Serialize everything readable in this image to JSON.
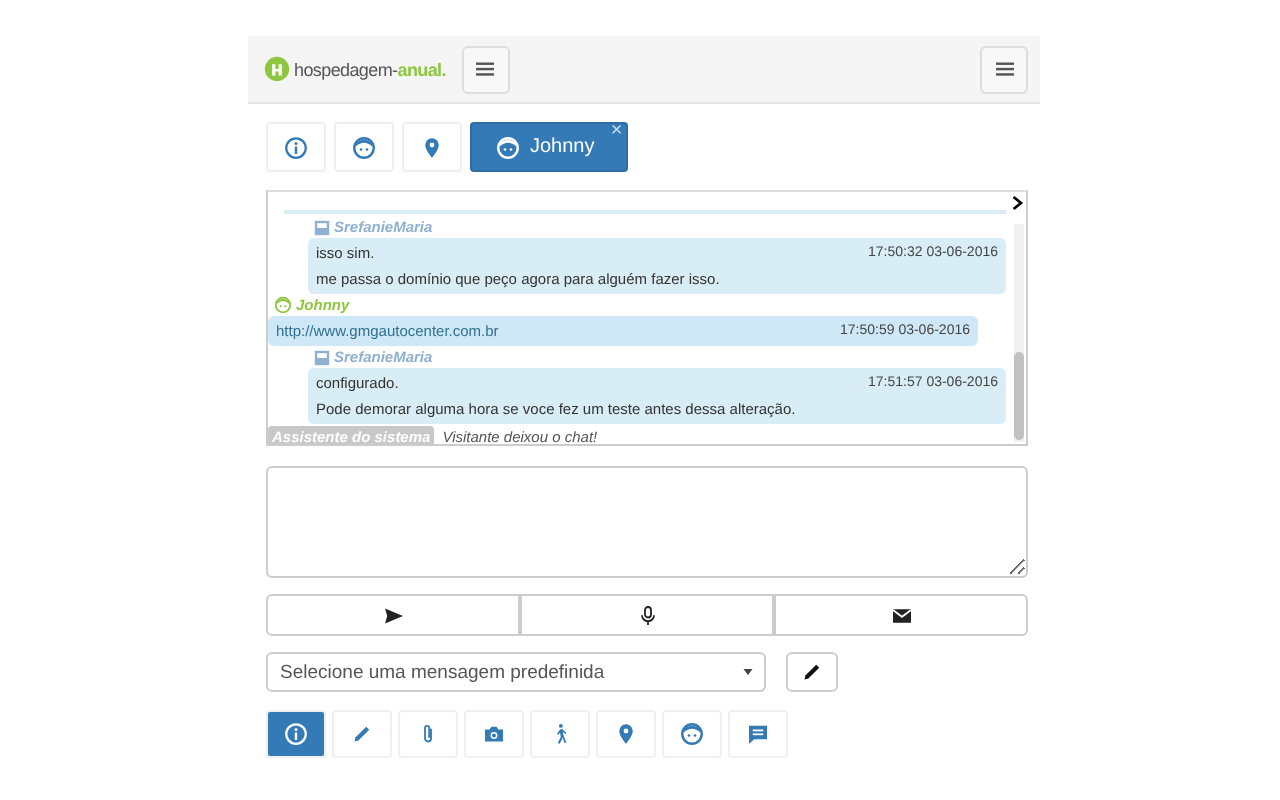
{
  "header": {
    "logo": {
      "part1": "hospedagem-",
      "part2": "anual."
    }
  },
  "tabs": [
    {
      "kind": "info",
      "selected": false
    },
    {
      "kind": "face",
      "selected": false
    },
    {
      "kind": "pin",
      "selected": false
    },
    {
      "kind": "face",
      "label": "Johnny",
      "selected": true,
      "close": "×"
    }
  ],
  "chat": {
    "messages": [
      {
        "kind": "operator",
        "author": "SrefanieMaria",
        "lines": [
          {
            "text": "isso sim.",
            "time": "17:50:32 03-06-2016"
          },
          {
            "text": "me passa o domínio que peço agora para alguém fazer isso."
          }
        ]
      },
      {
        "kind": "visitor",
        "author": "Johnny",
        "lines": [
          {
            "text": "http://www.gmgautocenter.com.br",
            "time": "17:50:59 03-06-2016"
          }
        ]
      },
      {
        "kind": "operator",
        "author": "SrefanieMaria",
        "lines": [
          {
            "text": "configurado.",
            "time": "17:51:57 03-06-2016"
          },
          {
            "text": "Pode demorar alguma hora se voce fez um teste antes dessa alteração."
          }
        ]
      },
      {
        "kind": "system",
        "author": "Assistente do sistema",
        "text": "Visitante deixou o chat!"
      }
    ]
  },
  "send_buttons": [
    {
      "kind": "send"
    },
    {
      "kind": "mic"
    },
    {
      "kind": "mail"
    }
  ],
  "predefined": {
    "placeholder": "Selecione uma mensagem predefinida"
  },
  "toolbar": [
    {
      "kind": "info",
      "selected": true
    },
    {
      "kind": "pencil",
      "selected": false
    },
    {
      "kind": "clip",
      "selected": false
    },
    {
      "kind": "camera",
      "selected": false
    },
    {
      "kind": "walk",
      "selected": false
    },
    {
      "kind": "pin",
      "selected": false
    },
    {
      "kind": "face",
      "selected": false
    },
    {
      "kind": "chat",
      "selected": false
    }
  ]
}
